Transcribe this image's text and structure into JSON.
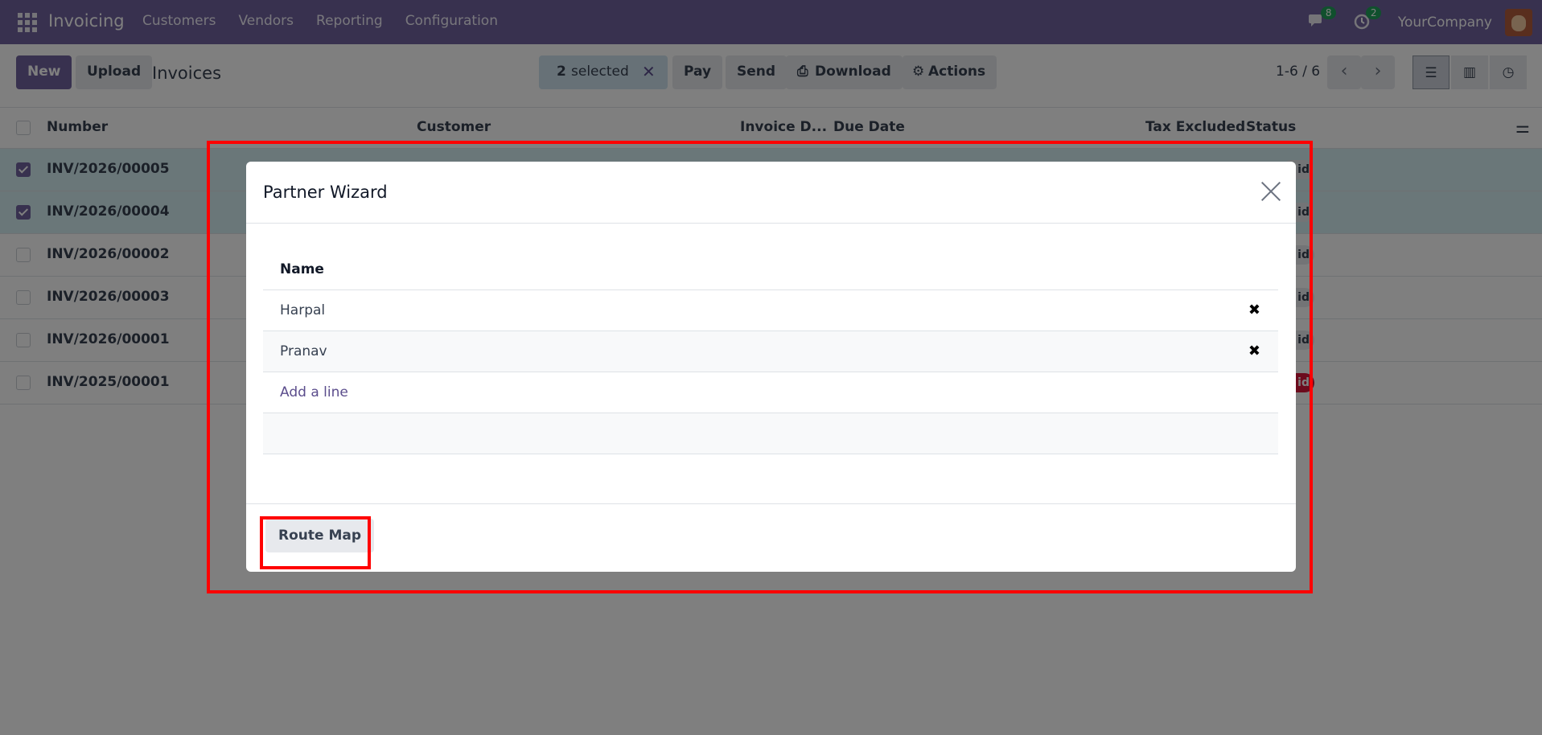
{
  "navbar": {
    "app_name": "Invoicing",
    "menu": [
      "Customers",
      "Vendors",
      "Reporting",
      "Configuration"
    ],
    "messages_count": "8",
    "activities_count": "2",
    "company": "YourCompany",
    "bg_color": "#71639e"
  },
  "control_panel": {
    "new_label": "New",
    "upload_label": "Upload",
    "title": "Invoices",
    "selected_count": "2",
    "selected_label": "selected",
    "pay_label": "Pay",
    "send_label": "Send",
    "download_label": "Download",
    "actions_label": "Actions",
    "pager": "1-6 / 6"
  },
  "list": {
    "columns": [
      "Number",
      "Customer",
      "Invoice D...",
      "Due Date",
      "Tax Excluded",
      "Status"
    ],
    "rows": [
      {
        "number": "INV/2026/00005",
        "selected": true,
        "status": "id"
      },
      {
        "number": "INV/2026/00004",
        "selected": true,
        "status": "id"
      },
      {
        "number": "INV/2026/00002",
        "selected": false,
        "status": "id"
      },
      {
        "number": "INV/2026/00003",
        "selected": false,
        "status": "id"
      },
      {
        "number": "INV/2026/00001",
        "selected": false,
        "status": "id"
      },
      {
        "number": "INV/2025/00001",
        "selected": false,
        "status": "id"
      }
    ]
  },
  "modal": {
    "title": "Partner Wizard",
    "column_header": "Name",
    "lines": [
      "Harpal",
      "Pranav"
    ],
    "add_line_label": "Add a line",
    "route_map_label": "Route Map"
  },
  "colors": {
    "accent": "#71639e",
    "highlight": "#ff0000",
    "danger": "#d9173b",
    "selected_row": "#d5eef2"
  }
}
